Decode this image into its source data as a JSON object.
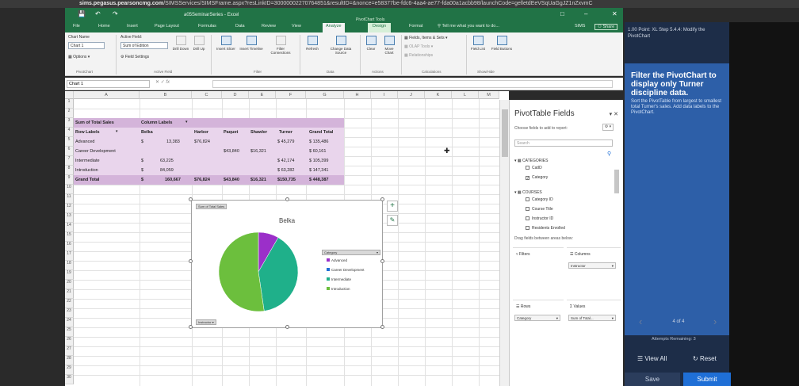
{
  "browser": {
    "host": "sims.pegasus.pearsoncmg.com",
    "url_rest": "/SIMSServices/SIMSFrame.aspx?resLinkID=30000002270764851&resultID=&nonce=e58377be-fdc6-4aa4-ae77-fda00a1acbb98/launchCode=gelletdEeVSqUaGgJZ1nZxvmC"
  },
  "excel": {
    "title": "a05SeminarSeries - Excel",
    "pivot_tools": "PivotChart Tools",
    "tabs": [
      "File",
      "Home",
      "Insert",
      "Page Layout",
      "Formulas",
      "Data",
      "Review",
      "View",
      "Analyze",
      "Design",
      "Format"
    ],
    "tell_me": "Tell me what you want to do...",
    "user": "SIMS",
    "share": "Share",
    "ribbon": {
      "chart_name_label": "Chart Name",
      "chart_name_value": "Chart 1",
      "options": "Options",
      "pivotchart_group": "PivotChart",
      "active_field_label": "Active Field:",
      "active_field_value": "Sum of Edition",
      "field_settings": "Field Settings",
      "drill_down": "Drill Down",
      "drill_up": "Drill Up",
      "active_field_group": "Active Field",
      "insert_slicer": "Insert Slicer",
      "insert_timeline": "Insert Timeline",
      "filter_connections": "Filter Connections",
      "filter_group": "Filter",
      "refresh": "Refresh",
      "change_data_source": "Change Data Source",
      "data_group": "Data",
      "clear": "Clear",
      "move_chart": "Move Chart",
      "actions_group": "Actions",
      "fields_items_sets": "Fields, Items & Sets",
      "olap_tools": "OLAP Tools",
      "relationships": "Relationships",
      "calculations_group": "Calculations",
      "field_list": "Field List",
      "field_buttons": "Field Buttons",
      "show_hide_group": "Show/Hide"
    },
    "name_box": "Chart 1",
    "columns": [
      "A",
      "B",
      "C",
      "D",
      "E",
      "F",
      "G",
      "H",
      "I",
      "J",
      "K",
      "L",
      "M"
    ],
    "rows": [
      "1",
      "2",
      "3",
      "4",
      "5",
      "6",
      "7",
      "8",
      "9",
      "10",
      "11",
      "12",
      "13",
      "14",
      "15",
      "16",
      "17",
      "18",
      "19",
      "20",
      "21",
      "22",
      "23",
      "24",
      "25",
      "26",
      "27",
      "28",
      "29",
      "30"
    ]
  },
  "pivot_table": {
    "sum_label": "Sum of Total Sales",
    "column_labels": "Column Labels",
    "row_labels": "Row Labels",
    "instructors": [
      "Belka",
      "Harbor",
      "Paquet",
      "Shawler",
      "Turner"
    ],
    "grand_total": "Grand Total",
    "rows": [
      {
        "label": "Advanced",
        "belka": "$",
        "belka_val": "13,383",
        "harbor": "$76,824",
        "paquet": "",
        "shawler": "",
        "turner": "$ 45,279",
        "total": "$ 135,486"
      },
      {
        "label": "Career Development",
        "belka": "",
        "belka_val": "",
        "harbor": "",
        "paquet": "$43,840",
        "shawler": "$16,321",
        "turner": "",
        "total": "$ 60,161"
      },
      {
        "label": "Intermediate",
        "belka": "$",
        "belka_val": "63,225",
        "harbor": "",
        "paquet": "",
        "shawler": "",
        "turner": "$ 42,174",
        "total": "$ 105,399"
      },
      {
        "label": "Introduction",
        "belka": "$",
        "belka_val": "84,059",
        "harbor": "",
        "paquet": "",
        "shawler": "",
        "turner": "$ 63,282",
        "total": "$ 147,341"
      }
    ],
    "grand_row": {
      "label": "Grand Total",
      "belka": "$",
      "belka_val": "160,667",
      "harbor": "$76,824",
      "paquet": "$43,840",
      "shawler": "$16,321",
      "turner": "$150,735",
      "total": "$ 448,387"
    }
  },
  "chart": {
    "value_button": "Sum of Total Sales",
    "title": "Belka",
    "legend_title": "Category",
    "legend_items": [
      "Advanced",
      "Career Development",
      "Intermediate",
      "Introduction"
    ],
    "legend_colors": [
      "#9b2fc9",
      "#1f6fd6",
      "#1fb08a",
      "#6cbf3d"
    ],
    "axis_button": "Instructor",
    "slice_values": [
      13383,
      0,
      63225,
      84059
    ]
  },
  "pane": {
    "title": "PivotTable Fields",
    "choose": "Choose fields to add to report:",
    "search_placeholder": "Search",
    "groups": [
      {
        "name": "CATEGORIES",
        "fields": [
          {
            "name": "CatID",
            "checked": false
          },
          {
            "name": "Category",
            "checked": true
          }
        ]
      },
      {
        "name": "COURSES",
        "fields": [
          {
            "name": "Category ID",
            "checked": false
          },
          {
            "name": "Course Title",
            "checked": false
          },
          {
            "name": "Instructor ID",
            "checked": false
          },
          {
            "name": "Residents Enrolled",
            "checked": false
          }
        ]
      }
    ],
    "drag_hint": "Drag fields between areas below:",
    "filters": "Filters",
    "columns": "Columns",
    "columns_value": "Instructor",
    "rows": "Rows",
    "rows_value": "Category",
    "values": "Values",
    "values_value": "Sum of Total..."
  },
  "task": {
    "header": "1.00 Point: XL Step 5.4.4: Modify the PivotChart",
    "instruction": "Filter the PivotChart to display only Turner discipline data.",
    "detail": "Sort the PivotTable from largest to smallest total Turner's sales. Add data labels to the PivotChart.",
    "progress": "4 of 4",
    "attempts": "Attempts Remaining: 3",
    "view_all": "View All",
    "reset": "Reset",
    "save": "Save",
    "submit": "Submit"
  }
}
